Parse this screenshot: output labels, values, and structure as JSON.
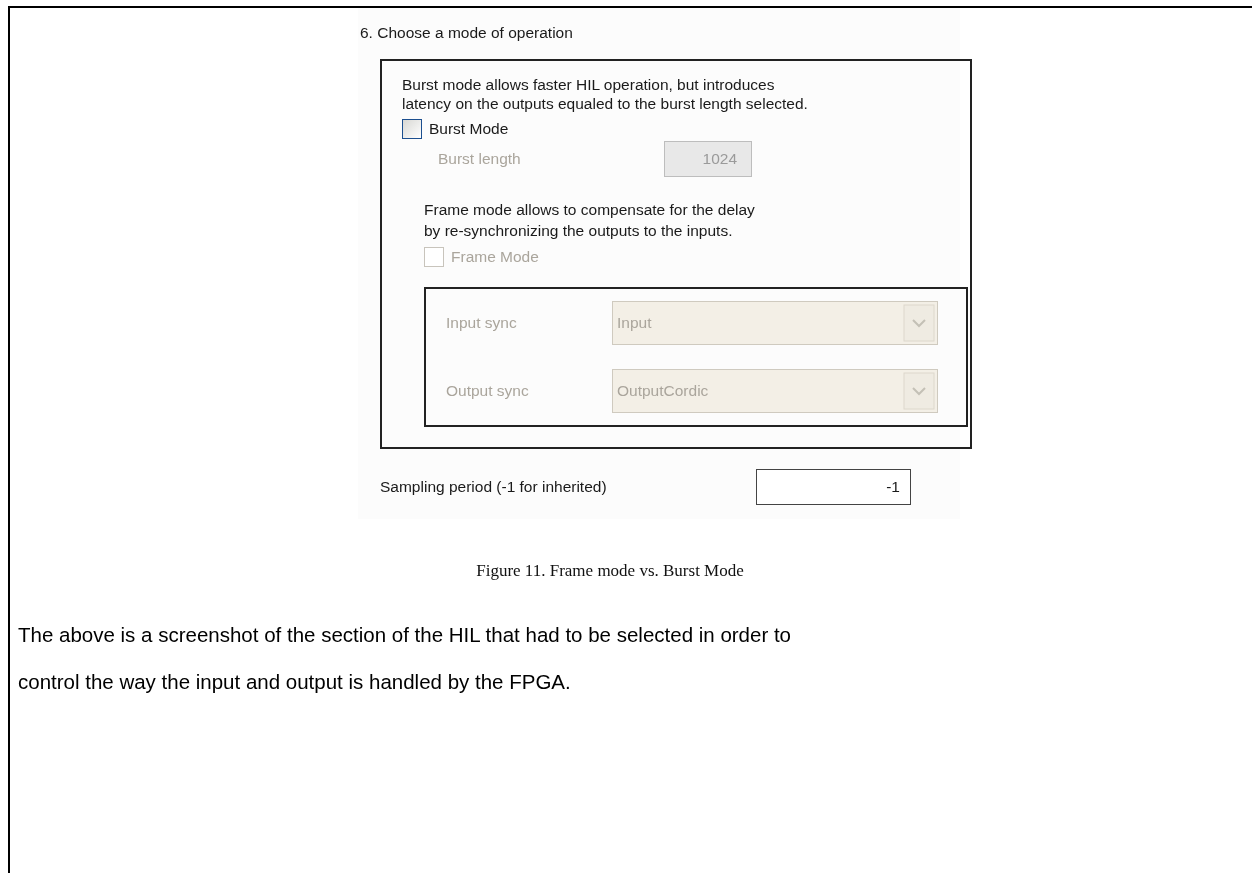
{
  "step_title": "6. Choose a mode of operation",
  "burst": {
    "description_lines": [
      "Burst mode allows faster HIL operation, but introduces",
      "latency on the outputs equaled to the burst length selected."
    ],
    "checkbox": {
      "label": "Burst Mode",
      "checked": false,
      "disabled": false
    },
    "length": {
      "label": "Burst length",
      "value": "1024",
      "disabled": true
    }
  },
  "frame": {
    "description_lines": [
      "Frame mode allows to compensate for the delay",
      " by re-synchronizing the outputs to the inputs."
    ],
    "checkbox": {
      "label": "Frame Mode",
      "checked": false,
      "disabled": true
    },
    "syncs": [
      {
        "label": "Input sync",
        "value": "Input",
        "disabled": true
      },
      {
        "label": "Output sync",
        "value": "OutputCordic",
        "disabled": true
      }
    ]
  },
  "sampling": {
    "label": "Sampling period (-1 for inherited)",
    "value": "-1"
  },
  "caption": "Figure 11. Frame mode vs. Burst Mode",
  "body_lines": [
    "The above is a screenshot of the section of the HIL that had to be selected in order to",
    "control the way the input and output is handled by the FPGA."
  ]
}
